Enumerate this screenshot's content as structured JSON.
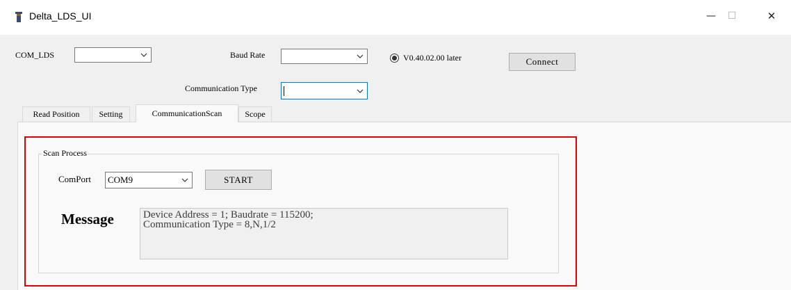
{
  "window": {
    "title": "Delta_LDS_UI",
    "controls": {
      "minimize": "—",
      "maximize": "☐",
      "close": "✕"
    }
  },
  "connection": {
    "com_label": "COM_LDS",
    "com_value": "",
    "baud_label": "Baud Rate",
    "baud_value": "",
    "version_option": "V0.40.02.00 later",
    "version_selected": true,
    "connect_label": "Connect",
    "comm_type_label": "Communication Type",
    "comm_type_value": ""
  },
  "tabs": [
    {
      "label": "Read Position",
      "active": false
    },
    {
      "label": "Setting",
      "active": false
    },
    {
      "label": "CommunicationScan",
      "active": true
    },
    {
      "label": "Scope",
      "active": false
    }
  ],
  "scan": {
    "group_title": "Scan Process",
    "comport_label": "ComPort",
    "comport_value": "COM9",
    "start_label": "START",
    "message_label": "Message",
    "message_text": "Device Address = 1; Baudrate = 115200;\nCommunication Type = 8,N,1/2"
  },
  "colors": {
    "highlight": "#e00000",
    "focus_border": "#0078d7",
    "background": "#f0f0f0"
  }
}
